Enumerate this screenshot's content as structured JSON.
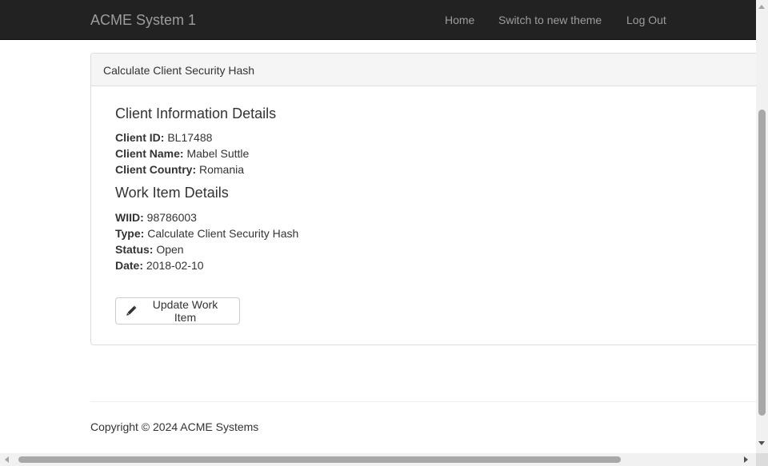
{
  "navbar": {
    "brand": "ACME System 1",
    "links": [
      "Home",
      "Switch to new theme",
      "Log Out"
    ],
    "background_color": "#222222",
    "link_color": "#9d9d9d"
  },
  "panel": {
    "title": "Calculate Client Security Hash",
    "client_section": {
      "heading": "Client Information Details",
      "fields": [
        {
          "label": "Client ID:",
          "value": "BL17488"
        },
        {
          "label": "Client Name:",
          "value": "Mabel Suttle"
        },
        {
          "label": "Client Country:",
          "value": "Romania"
        }
      ]
    },
    "work_section": {
      "heading": "Work Item Details",
      "fields": [
        {
          "label": "WIID:",
          "value": "98786003"
        },
        {
          "label": "Type:",
          "value": "Calculate Client Security Hash"
        },
        {
          "label": "Status:",
          "value": "Open"
        },
        {
          "label": "Date:",
          "value": "2018-02-10"
        }
      ]
    },
    "update_button": {
      "label": "Update Work Item",
      "icon": "pencil-icon"
    }
  },
  "footer": {
    "copyright": "Copyright © 2024 ACME Systems"
  }
}
